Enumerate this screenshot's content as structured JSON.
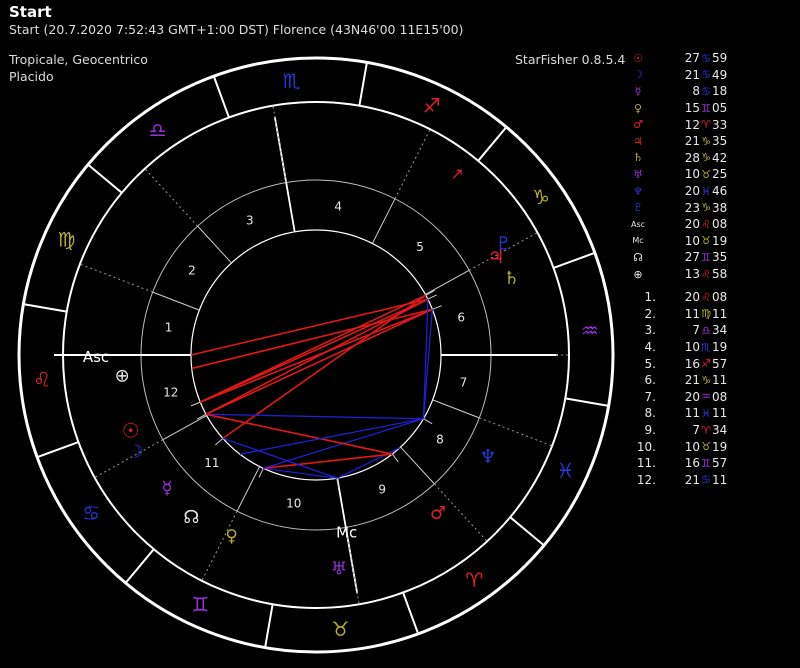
{
  "header": {
    "title": "Start",
    "subtitle": "Start (20.7.2020 7:52:43 GMT+1:00 DST) Florence (43N46'00 11E15'00)"
  },
  "settings": {
    "zodiac": "Tropicale, Geocentrico",
    "houses": "Placido",
    "app": "StarFisher 0.8.5.4"
  },
  "colors": {
    "fire": "#e0202a",
    "earth": "#b8b030",
    "air": "#9a30e0",
    "water": "#2838d8",
    "ring": "#ffffff",
    "aspect_red": "#e01818",
    "aspect_blue": "#2020e0"
  },
  "wheel": {
    "ascendant_label": "Asc",
    "mc_label": "Mc",
    "signs": [
      {
        "id": "aries",
        "glyph": "♈",
        "element": "fire"
      },
      {
        "id": "taurus",
        "glyph": "♉",
        "element": "earth"
      },
      {
        "id": "gemini",
        "glyph": "♊",
        "element": "air"
      },
      {
        "id": "cancer",
        "glyph": "♋",
        "element": "water"
      },
      {
        "id": "leo",
        "glyph": "♌",
        "element": "fire"
      },
      {
        "id": "virgo",
        "glyph": "♍",
        "element": "earth"
      },
      {
        "id": "libra",
        "glyph": "♎",
        "element": "air"
      },
      {
        "id": "scorpio",
        "glyph": "♏",
        "element": "water"
      },
      {
        "id": "sagittarius",
        "glyph": "♐",
        "element": "fire"
      },
      {
        "id": "capricorn",
        "glyph": "♑",
        "element": "earth"
      },
      {
        "id": "aquarius",
        "glyph": "♒",
        "element": "air"
      },
      {
        "id": "pisces",
        "glyph": "♓",
        "element": "water"
      }
    ],
    "house_numbers": [
      "1",
      "2",
      "3",
      "4",
      "5",
      "6",
      "7",
      "8",
      "9",
      "10",
      "11",
      "12"
    ]
  },
  "planets": [
    {
      "id": "sun",
      "glyph": "☉",
      "color": "#e0202a",
      "deg": "27",
      "sign": "♋",
      "sign_color": "#2838d8",
      "min": "59",
      "lon": 117.98
    },
    {
      "id": "moon",
      "glyph": "☽",
      "color": "#2838d8",
      "deg": "21",
      "sign": "♋",
      "sign_color": "#2838d8",
      "min": "49",
      "lon": 111.82
    },
    {
      "id": "mercury",
      "glyph": "☿",
      "color": "#9a30e0",
      "deg": "8",
      "sign": "♋",
      "sign_color": "#2838d8",
      "min": "18",
      "lon": 98.3
    },
    {
      "id": "venus",
      "glyph": "♀",
      "color": "#b8b030",
      "deg": "15",
      "sign": "♊",
      "sign_color": "#9a30e0",
      "min": "05",
      "lon": 75.08
    },
    {
      "id": "mars",
      "glyph": "♂",
      "color": "#e0202a",
      "deg": "12",
      "sign": "♈",
      "sign_color": "#e0202a",
      "min": "33",
      "lon": 12.55
    },
    {
      "id": "jupiter",
      "glyph": "♃",
      "color": "#e0202a",
      "deg": "21",
      "sign": "♑",
      "sign_color": "#b8b030",
      "min": "35",
      "lon": 291.58
    },
    {
      "id": "saturn",
      "glyph": "♄",
      "color": "#b8b030",
      "deg": "28",
      "sign": "♑",
      "sign_color": "#b8b030",
      "min": "42",
      "lon": 298.7
    },
    {
      "id": "uranus",
      "glyph": "♅",
      "color": "#9a30e0",
      "deg": "10",
      "sign": "♉",
      "sign_color": "#b8b030",
      "min": "25",
      "lon": 40.42
    },
    {
      "id": "neptune",
      "glyph": "♆",
      "color": "#2838d8",
      "deg": "20",
      "sign": "♓",
      "sign_color": "#2838d8",
      "min": "46",
      "lon": 350.77
    },
    {
      "id": "pluto",
      "glyph": "♇",
      "color": "#2838d8",
      "deg": "23",
      "sign": "♑",
      "sign_color": "#b8b030",
      "min": "38",
      "lon": 293.63
    },
    {
      "id": "ascendant",
      "glyph": "Asc",
      "color": "#e6e6e6",
      "deg": "20",
      "sign": "♌",
      "sign_color": "#e0202a",
      "min": "08",
      "lon": 140.13
    },
    {
      "id": "midheaven",
      "glyph": "Mc",
      "color": "#e6e6e6",
      "deg": "10",
      "sign": "♉",
      "sign_color": "#b8b030",
      "min": "19",
      "lon": 40.32
    },
    {
      "id": "north-node",
      "glyph": "☊",
      "color": "#e6e6e6",
      "deg": "27",
      "sign": "♊",
      "sign_color": "#9a30e0",
      "min": "35",
      "lon": 87.58
    },
    {
      "id": "part-of-fortune",
      "glyph": "⊕",
      "color": "#e6e6e6",
      "deg": "13",
      "sign": "♌",
      "sign_color": "#e0202a",
      "min": "58",
      "lon": 133.97
    }
  ],
  "cusps": [
    {
      "n": "1.",
      "deg": "20",
      "sign": "♌",
      "sign_color": "#e0202a",
      "min": "08"
    },
    {
      "n": "2.",
      "deg": "11",
      "sign": "♍",
      "sign_color": "#b8b030",
      "min": "11"
    },
    {
      "n": "3.",
      "deg": "7",
      "sign": "♎",
      "sign_color": "#9a30e0",
      "min": "34"
    },
    {
      "n": "4.",
      "deg": "10",
      "sign": "♏",
      "sign_color": "#2838d8",
      "min": "19"
    },
    {
      "n": "5.",
      "deg": "16",
      "sign": "♐",
      "sign_color": "#e0202a",
      "min": "57"
    },
    {
      "n": "6.",
      "deg": "21",
      "sign": "♑",
      "sign_color": "#b8b030",
      "min": "11"
    },
    {
      "n": "7.",
      "deg": "20",
      "sign": "♒",
      "sign_color": "#9a30e0",
      "min": "08"
    },
    {
      "n": "8.",
      "deg": "11",
      "sign": "♓",
      "sign_color": "#2838d8",
      "min": "11"
    },
    {
      "n": "9.",
      "deg": "7",
      "sign": "♈",
      "sign_color": "#e0202a",
      "min": "34"
    },
    {
      "n": "10.",
      "deg": "10",
      "sign": "♉",
      "sign_color": "#b8b030",
      "min": "19"
    },
    {
      "n": "11.",
      "deg": "16",
      "sign": "♊",
      "sign_color": "#9a30e0",
      "min": "57"
    },
    {
      "n": "12.",
      "deg": "21",
      "sign": "♋",
      "sign_color": "#2838d8",
      "min": "11"
    }
  ]
}
